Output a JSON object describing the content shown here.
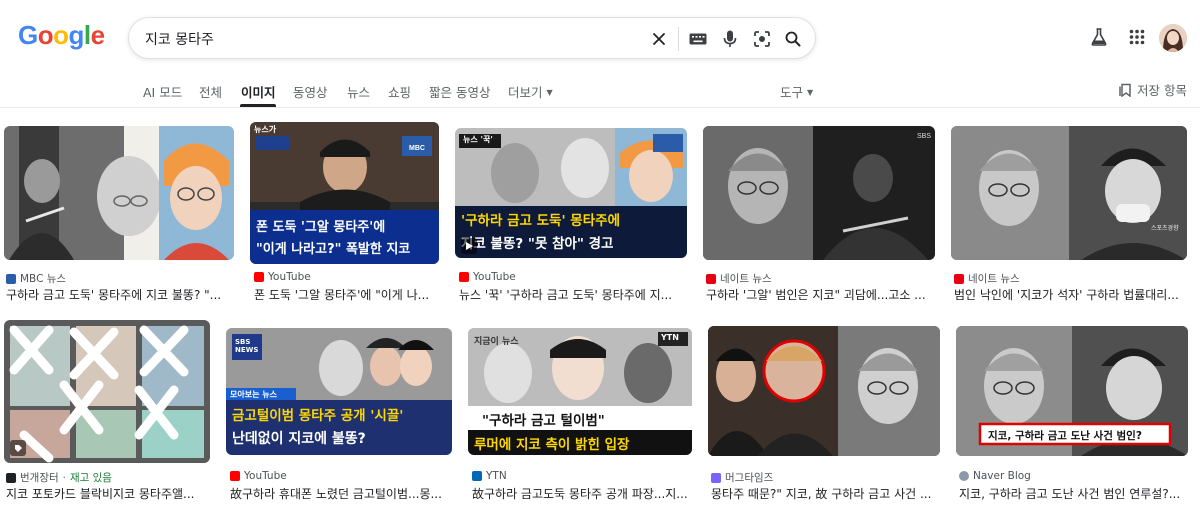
{
  "search": {
    "query": "지코 몽타주"
  },
  "icons": {
    "clear": "close-icon",
    "keyboard": "keyboard-icon",
    "mic": "mic-icon",
    "lens": "camera-lens-icon",
    "search": "search-icon",
    "labs": "flask-icon",
    "apps": "apps-grid-icon",
    "saved": "bookmark-icon"
  },
  "tabs": [
    {
      "label": "AI 모드"
    },
    {
      "label": "전체"
    },
    {
      "label": "이미지"
    },
    {
      "label": "동영상"
    },
    {
      "label": "뉴스"
    },
    {
      "label": "쇼핑"
    },
    {
      "label": "짧은 동영상"
    },
    {
      "label": "더보기"
    }
  ],
  "tools_label": "도구",
  "saved_label": "저장 항목",
  "results_row1": [
    {
      "source": "MBC 뉴스",
      "title": "구하라 금고 도둑' 몽타주에 지코 불똥? \"...",
      "favicon_color": "#2a5caa"
    },
    {
      "source": "YouTube",
      "title": "폰 도둑 '그알 몽타주'에 \"이게 나...",
      "favicon_color": "#ff0000",
      "overlay": [
        "폰 도둑 '그알 몽타주'에",
        "\"이게 나라고?\" 폭발한 지코"
      ],
      "badge": "뉴스가"
    },
    {
      "source": "YouTube",
      "title": "뉴스 '꾹' '구하라 금고 도둑' 몽타주에 지...",
      "favicon_color": "#ff0000",
      "overlay": [
        "'구하라 금고 도둑' 몽타주에",
        "지코 불똥? \"못 참아\" 경고"
      ],
      "badge": "뉴스 '꾹'"
    },
    {
      "source": "네이트 뉴스",
      "title": "구하라 '그알' 범인은 지코\" 괴담에...고소 ...",
      "favicon_color": "#e60012"
    },
    {
      "source": "네이트 뉴스",
      "title": "범인 낙인에 '지코가 석자' 구하라 법률대리...",
      "favicon_color": "#e60012"
    }
  ],
  "results_row2": [
    {
      "source": "번개장터",
      "extra": "재고 있음",
      "title": "지코 포토카드 블락비지코 몽타주앨...",
      "favicon_color": "#202124"
    },
    {
      "source": "YouTube",
      "title": "故구하라 휴대폰 노렸던 금고털이범...몽...",
      "favicon_color": "#ff0000",
      "overlay": [
        "금고털이범 몽타주 공개 '시끌'",
        "난데없이 지코에 불똥?"
      ],
      "badge": "모아보는 뉴스"
    },
    {
      "source": "YTN",
      "title": "故구하라 금고도둑 몽타주 공개 파장...지...",
      "favicon_color": "#0068b7",
      "overlay": [
        "\"구하라 금고 털이범\"",
        "루머에 지코 측이 밝힌 입장"
      ],
      "badge": "지금이 뉴스"
    },
    {
      "source": "머그타임즈",
      "title": "몽타주 때문?\" 지코, 故 구하라 금고 사건 ...",
      "favicon_color": "#7b61ff"
    },
    {
      "source": "Naver Blog",
      "title": "지코, 구하라 금고 도난 사건 범인 연루설?...",
      "favicon_color": "#8a9aa9",
      "overlay": [
        "지코, 구하라 금고 도난 사건 범인?"
      ]
    }
  ]
}
